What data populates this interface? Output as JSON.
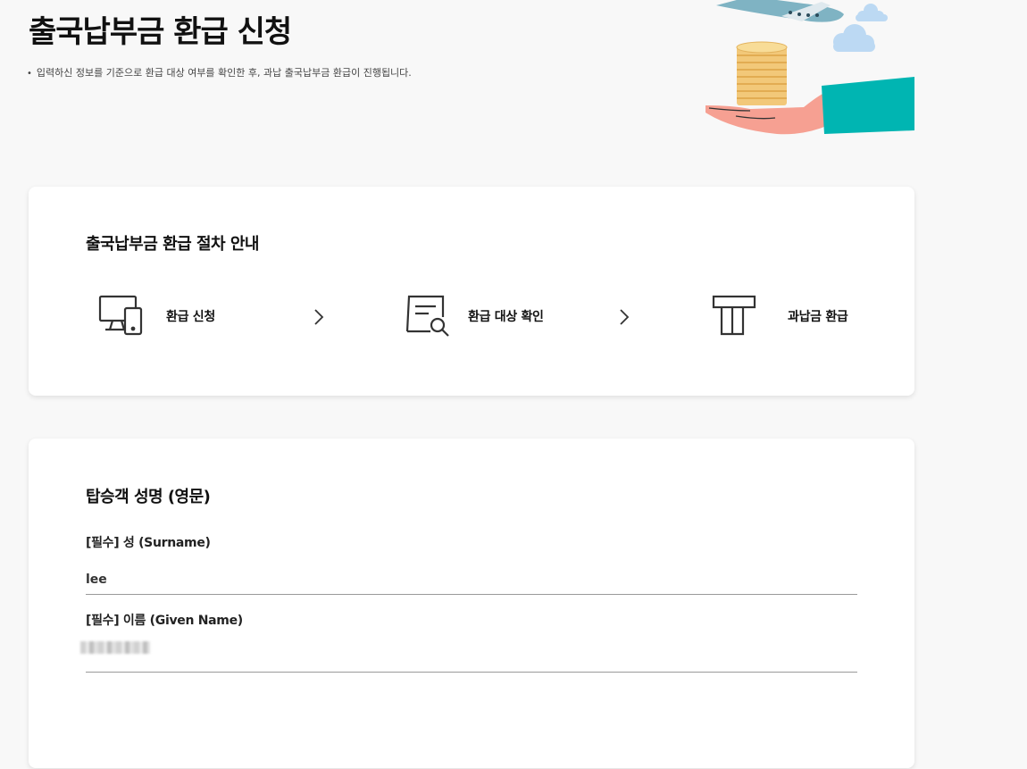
{
  "header": {
    "title": "출국납부금 환급 신청",
    "description": "입력하신 정보를 기준으로 환급 대상 여부를 확인한 후, 과납 출국납부금 환급이 진행됩니다."
  },
  "steps_card": {
    "title": "출국납부금 환급 절차 안내",
    "steps": [
      {
        "label": "환급 신청",
        "icon": "devices-icon"
      },
      {
        "label": "환급 대상 확인",
        "icon": "document-search-icon"
      },
      {
        "label": "과납금 환급",
        "icon": "refund-receipt-icon"
      }
    ]
  },
  "form_card": {
    "title": "탑승객 성명 (영문)",
    "fields": [
      {
        "label": "[필수] 성 (Surname)",
        "value": "lee"
      },
      {
        "label": "[필수] 이름 (Given Name)",
        "value": ""
      }
    ]
  },
  "colors": {
    "background": "#f8f8f8",
    "teal": "#00b5b2",
    "hand": "#f6a092",
    "coin": "#f2c879",
    "cloud": "#bcd9f3"
  }
}
